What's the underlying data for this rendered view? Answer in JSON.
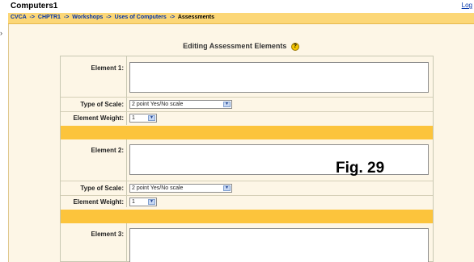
{
  "header": {
    "title": "Computers1",
    "login_link": "Log"
  },
  "breadcrumbs": {
    "items": [
      "CVCA",
      "CHPTR1",
      "Workshops",
      "Uses of Computers"
    ],
    "separator": "->",
    "current": "Assessments"
  },
  "page": {
    "heading": "Editing Assessment Elements",
    "help_icon": "?"
  },
  "elements": [
    {
      "label": "Element 1:",
      "scale_label": "Type of Scale:",
      "scale_value": "2 point Yes/No scale",
      "weight_label": "Element Weight:",
      "weight_value": "1"
    },
    {
      "label": "Element 2:",
      "scale_label": "Type of Scale:",
      "scale_value": "2 point Yes/No scale",
      "weight_label": "Element Weight:",
      "weight_value": "1"
    },
    {
      "label": "Element 3:"
    }
  ],
  "figure_caption": "Fig. 29",
  "colors": {
    "navbar": "#fcd777",
    "separator": "#fcc43c",
    "form_bg": "#fdf6e6",
    "link": "#0033aa"
  }
}
